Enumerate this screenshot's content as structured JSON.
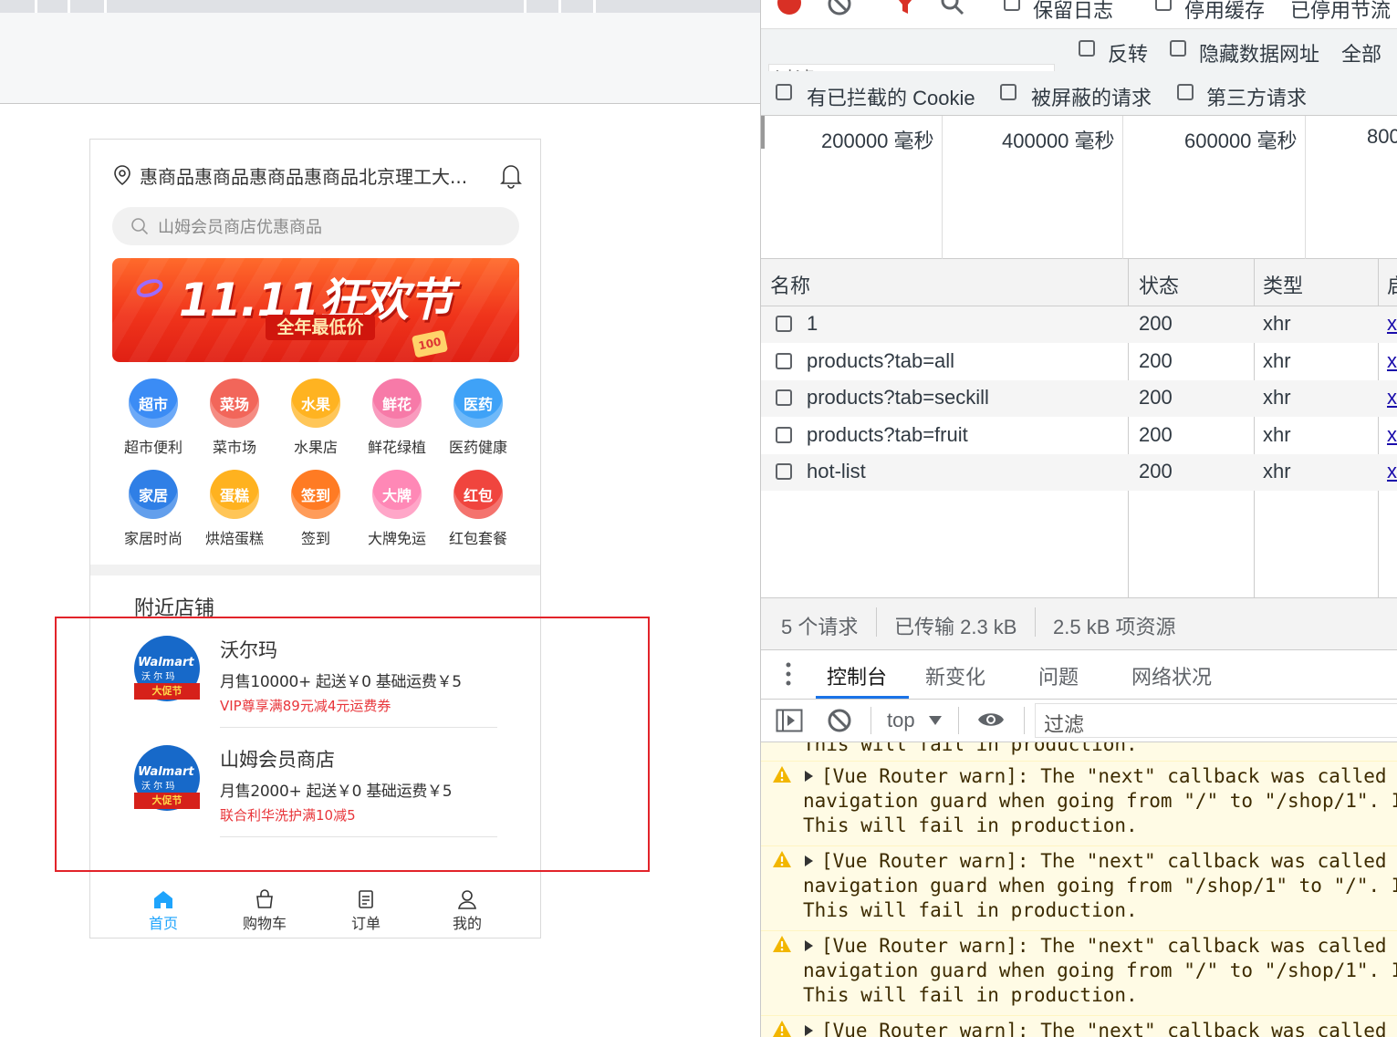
{
  "app": {
    "address": "惠商品惠商品惠商品惠商品北京理工大...",
    "search_placeholder": "山姆会员商店优惠商品",
    "banner": {
      "title": "11.11狂欢节",
      "subtitle": "全年最低价",
      "coupon": "100"
    },
    "categories": [
      {
        "icon_text": "超市",
        "label": "超市便利",
        "color": "#3b8cf5"
      },
      {
        "icon_text": "菜场",
        "label": "菜市场",
        "color": "#f2665a"
      },
      {
        "icon_text": "水果",
        "label": "水果店",
        "color": "#ffb321"
      },
      {
        "icon_text": "鲜花",
        "label": "鲜花绿植",
        "color": "#f77aa8"
      },
      {
        "icon_text": "医药",
        "label": "医药健康",
        "color": "#3fa2f7"
      },
      {
        "icon_text": "家居",
        "label": "家居时尚",
        "color": "#2f7fe6"
      },
      {
        "icon_text": "蛋糕",
        "label": "烘焙蛋糕",
        "color": "#ffb21f"
      },
      {
        "icon_text": "签到",
        "label": "签到",
        "color": "#ff7b23"
      },
      {
        "icon_text": "大牌",
        "label": "大牌免运",
        "color": "#ff88b6"
      },
      {
        "icon_text": "红包",
        "label": "红包套餐",
        "color": "#f0453e"
      }
    ],
    "nearby_title": "附近店铺",
    "shops": [
      {
        "name": "沃尔玛",
        "meta": "月售10000+   起送￥0   基础运费￥5",
        "promo": "VIP尊享满89元减4元运费券",
        "logo_text": "Walmart",
        "logo_sub": "沃 尔 玛",
        "logo_band": "大促节"
      },
      {
        "name": "山姆会员商店",
        "meta": "月售2000+   起送￥0   基础运费￥5",
        "promo": "联合利华洗护满10减5",
        "logo_text": "Walmart",
        "logo_sub": "沃 尔 玛",
        "logo_band": "大促节"
      }
    ],
    "tabs": [
      {
        "label": "首页",
        "icon": "home-icon",
        "active": true
      },
      {
        "label": "购物车",
        "icon": "cart-icon",
        "active": false
      },
      {
        "label": "订单",
        "icon": "order-icon",
        "active": false
      },
      {
        "label": "我的",
        "icon": "user-icon",
        "active": false
      }
    ],
    "accent": "#1fa4fc"
  },
  "devtools": {
    "toolbar": {
      "preserve_log": "保留日志",
      "disable_cache": "停用缓存",
      "throttle": "已停用节流"
    },
    "filter_placeholder": "过滤",
    "invert": "反转",
    "hide_data_urls": "隐藏数据网址",
    "all": "全部",
    "blocked_cookies": "有已拦截的 Cookie",
    "blocked_requests": "被屏蔽的请求",
    "third_party": "第三方请求",
    "timeline": [
      "200000 毫秒",
      "400000 毫秒",
      "600000 毫秒",
      "800"
    ],
    "columns": {
      "name": "名称",
      "status": "状态",
      "type": "类型",
      "initiator": "启"
    },
    "requests": [
      {
        "name": "1",
        "status": "200",
        "type": "xhr",
        "initiator": "x"
      },
      {
        "name": "products?tab=all",
        "status": "200",
        "type": "xhr",
        "initiator": "x"
      },
      {
        "name": "products?tab=seckill",
        "status": "200",
        "type": "xhr",
        "initiator": "x"
      },
      {
        "name": "products?tab=fruit",
        "status": "200",
        "type": "xhr",
        "initiator": "x"
      },
      {
        "name": "hot-list",
        "status": "200",
        "type": "xhr",
        "initiator": "x"
      }
    ],
    "summary": {
      "requests": "5 个请求",
      "transferred": "已传输 2.3 kB",
      "resources": "2.5 kB 项资源"
    },
    "drawer_tabs": [
      "控制台",
      "新变化",
      "问题",
      "网络状况"
    ],
    "console_context": "top",
    "console_filter": "过滤",
    "console_lines": {
      "top": "This will fail in production.",
      "messages": [
        [
          "[Vue Router warn]: The \"next\" callback was called",
          "navigation guard when going from \"/\" to \"/shop/1\". I",
          "This will fail in production."
        ],
        [
          "[Vue Router warn]: The \"next\" callback was called",
          "navigation guard when going from \"/shop/1\" to \"/\". I",
          "This will fail in production."
        ],
        [
          "[Vue Router warn]: The \"next\" callback was called",
          "navigation guard when going from \"/\" to \"/shop/1\". I",
          "This will fail in production."
        ],
        [
          "[Vue Router warn]: The \"next\" callback was called"
        ]
      ]
    }
  }
}
